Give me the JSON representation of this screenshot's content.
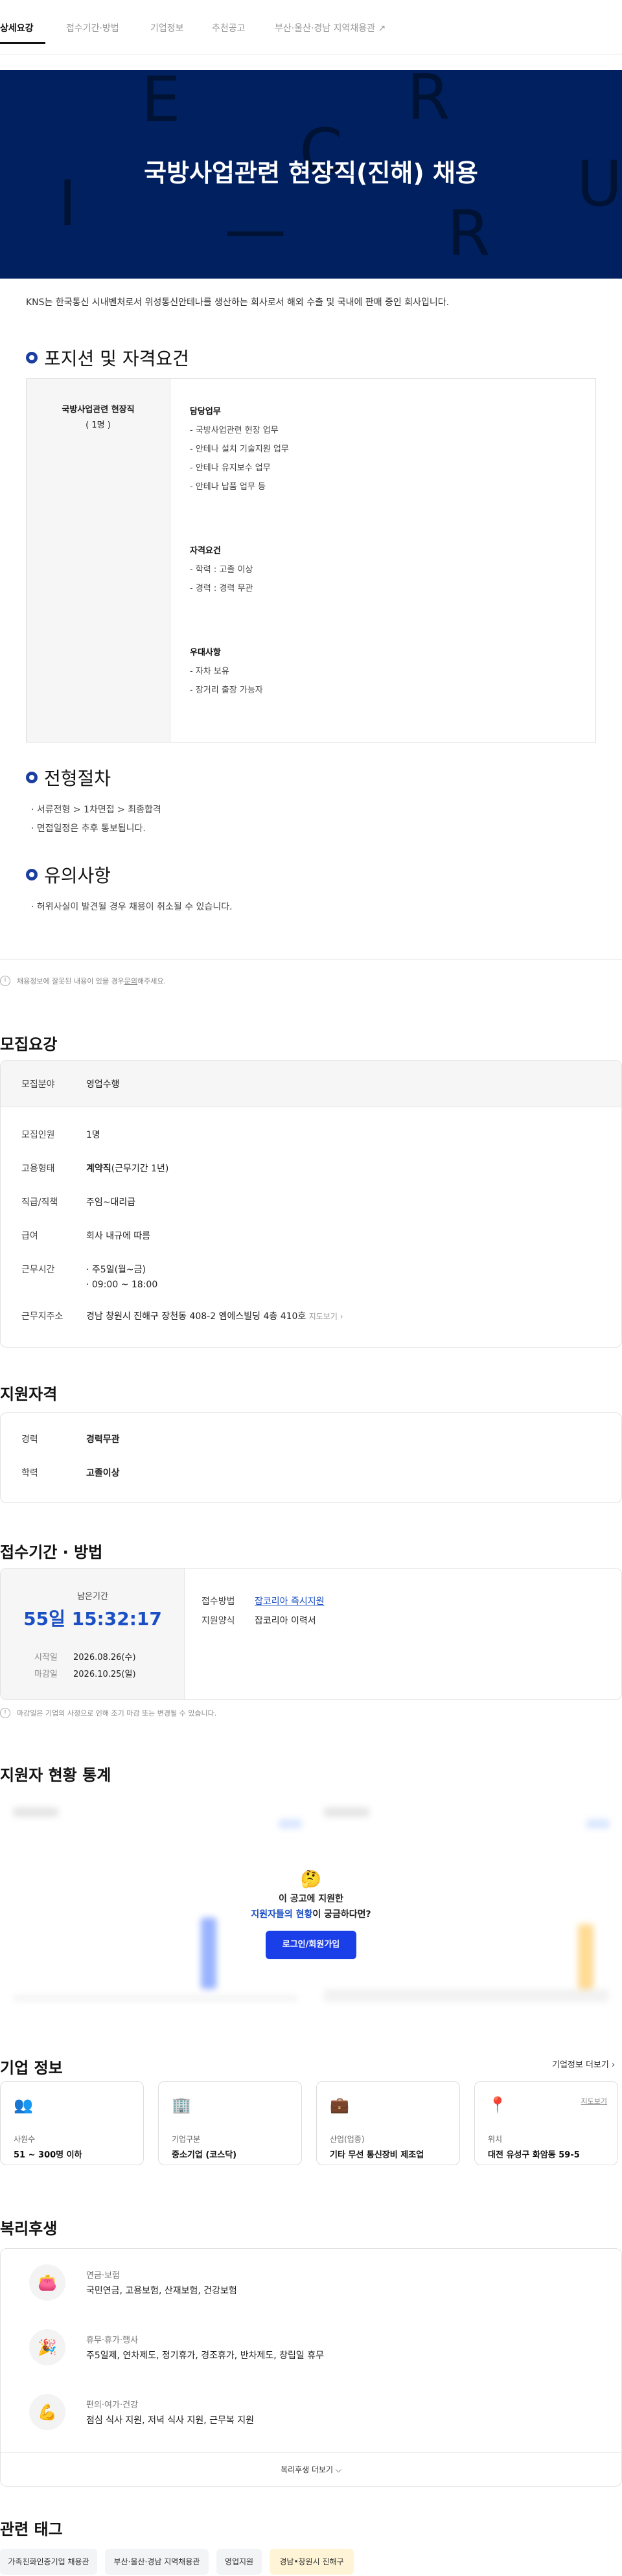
{
  "tabs": [
    "상세요강",
    "접수기간·방법",
    "기업정보",
    "추천공고",
    "부산·울산·경남 지역채용관"
  ],
  "hero": {
    "title": "국방사업관련 현장직(진해)  채용"
  },
  "intro": "KNS는 한국통신 시내벤처로서 위성통신안테나를 생산하는 회사로서 해외 수출 및 국내에 판매 중인 회사입니다.",
  "position": {
    "heading": "포지션 및 자격요건",
    "job_title": "국방사업관련 현장직",
    "job_count": "( 1명 )",
    "duties_title": "담당업무",
    "duties": [
      "- 국방사업관련 현장 업무",
      "- 안테나 설치 기술지원 업무",
      "- 안테나 유지보수 업무",
      "- 안테나 납품 업무 등"
    ],
    "req_title": "자격요건",
    "reqs": [
      "- 학력 : 고졸 이상",
      "- 경력 : 경력 무관"
    ],
    "pref_title": "우대사항",
    "prefs": [
      "-  자차 보유",
      "- 장거리 출장 가능자"
    ]
  },
  "process": {
    "heading": "전형절차",
    "lines": [
      "· 서류전형 > 1차면접 > 최종합격",
      "· 면접일정은 추후 통보됩니다."
    ]
  },
  "caution": {
    "heading": "유의사항",
    "lines": [
      "· 허위사실이 발견될 경우 채용이 취소될 수 있습니다."
    ]
  },
  "report_note": {
    "text": "채용정보에 잘못된 내용이 있을 경우 ",
    "link": "문의",
    "tail": "해주세요."
  },
  "recruit": {
    "title": "모집요강",
    "field_label": "모집분야",
    "field_value": "영업수행",
    "rows": [
      {
        "k": "모집인원",
        "v": "1명"
      },
      {
        "k": "고용형태",
        "v": "계약직",
        "extra": "(근무기간 1년)"
      },
      {
        "k": "직급/직책",
        "v": "주임~대리급"
      },
      {
        "k": "급여",
        "v": "회사 내규에 따름"
      },
      {
        "k": "근무시간",
        "v": "· 주5일(월~금)",
        "v2": "· 09:00 ~ 18:00"
      },
      {
        "k": "근무지주소",
        "v": "경남 창원시 진해구 장천동 408-2 엠에스빌딩 4층 410호",
        "extra": "지도보기 ›"
      }
    ]
  },
  "qual": {
    "title": "지원자격",
    "rows": [
      {
        "k": "경력",
        "v": "경력무관"
      },
      {
        "k": "학력",
        "v": "고졸이상"
      }
    ]
  },
  "period": {
    "title": "접수기간 · 방법",
    "remain_label": "남은기간",
    "remain": "55일 15:32:17",
    "start_label": "시작일",
    "start": "2026.08.26(수)",
    "end_label": "마감일",
    "end": "2026.10.25(일)",
    "method_label": "접수방법",
    "method": "잡코리아 즉시지원",
    "form_label": "지원양식",
    "form": "잡코리아 이력서",
    "note": "마감일은 기업의 사정으로 인해 조기 마감 또는 변경될 수 있습니다."
  },
  "stats": {
    "title": "지원자 현황 통계",
    "prompt_line1": "이 공고에 지원한",
    "prompt_highlight": "지원자들의 현황",
    "prompt_line2_tail": "이 궁금하다면?",
    "button": "로그인/회원가입"
  },
  "company": {
    "title": "기업 정보",
    "more": "기업정보 더보기 ›",
    "map_link": "지도보기",
    "cards": [
      {
        "label": "사원수",
        "value": "51 ~ 300명 이하",
        "icon": "people-icon"
      },
      {
        "label": "기업구분",
        "value": "중소기업 (코스닥)",
        "icon": "building-icon"
      },
      {
        "label": "산업(업종)",
        "value": "기타 무선 통신장비 제조업",
        "icon": "briefcase-icon"
      },
      {
        "label": "위치",
        "value": "대전 유성구 화암동 59-5",
        "icon": "location-pin-icon"
      }
    ]
  },
  "welfare": {
    "title": "복리후생",
    "items": [
      {
        "cat": "연금·보험",
        "items": "국민연금, 고용보험, 산재보험, 건강보험",
        "icon": "wallet-icon"
      },
      {
        "cat": "휴무·휴가·행사",
        "items": "주5일제, 연차제도, 정기휴가, 경조휴가, 반차제도, 창립일 휴무",
        "icon": "party-popper-icon"
      },
      {
        "cat": "편의·여가·건강",
        "items": "점심 식사 지원, 저녁 식사 지원, 근무복 지원",
        "icon": "muscle-icon"
      }
    ],
    "more": "복리후생 더보기 ⌵"
  },
  "tags": {
    "title": "관련 태그",
    "items": [
      "가족친화인증기업 채용관",
      "부산·울산·경남 지역채용관",
      "영업지원",
      "경남•창원시 진해구"
    ]
  }
}
